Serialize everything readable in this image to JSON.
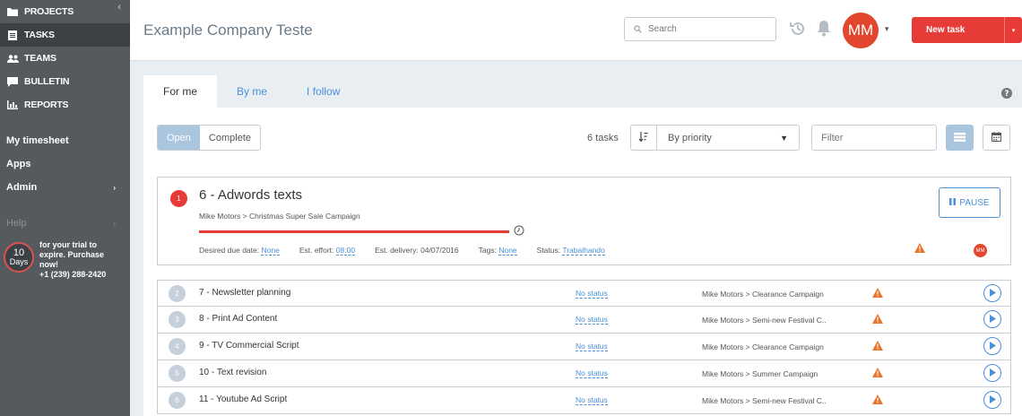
{
  "sidebar": {
    "collapse_glyph": "‹",
    "nav": [
      {
        "label": "PROJECTS",
        "icon": "folder-icon"
      },
      {
        "label": "TASKS",
        "icon": "tasks-icon"
      },
      {
        "label": "TEAMS",
        "icon": "teams-icon"
      },
      {
        "label": "BULLETIN",
        "icon": "bulletin-icon"
      },
      {
        "label": "REPORTS",
        "icon": "reports-icon"
      }
    ],
    "active_nav": "TASKS",
    "links": [
      {
        "label": "My timesheet"
      },
      {
        "label": "Apps"
      },
      {
        "label": "Admin",
        "caret": "›"
      }
    ],
    "help": {
      "label": "Help",
      "caret": "›"
    },
    "trial": {
      "days_number": "10",
      "days_unit": "Days",
      "line1": "for your trial to",
      "line2": "expire. Purchase",
      "line3": "now!",
      "phone": "+1 (239) 288-2420"
    }
  },
  "header": {
    "company": "Example Company Teste",
    "search_placeholder": "Search",
    "avatar_initials": "MM",
    "avatar_caret": "▾",
    "new_task_label": "New task",
    "new_task_caret": "▾",
    "colors": {
      "accent": "#e63b36",
      "avatar": "#e2462c",
      "link": "#4a90d9"
    }
  },
  "tabs": [
    {
      "label": "For me",
      "active": true
    },
    {
      "label": "By me",
      "active": false
    },
    {
      "label": "I follow",
      "active": false
    }
  ],
  "toolbar": {
    "open_label": "Open",
    "complete_label": "Complete",
    "task_count": "6 tasks",
    "sort_value": "By priority",
    "sort_caret": "▼",
    "filter_placeholder": "Filter"
  },
  "expanded_task": {
    "number": "1",
    "title": "6 - Adwords texts",
    "breadcrumb": "Mike Motors > Christmas Super Sale Campaign",
    "due_label": "Desired due date:",
    "due_value": "None",
    "effort_label": "Est. effort:",
    "effort_value": "08:00",
    "delivery": "Est. delivery: 04/07/2016",
    "tags_label": "Tags:",
    "tags_value": "None",
    "status_label": "Status:",
    "status_value": "Trabalhando",
    "pause_label": "PAUSE",
    "assignee_initials": "MM"
  },
  "tasks": [
    {
      "number": "2",
      "title": "7 - Newsletter planning",
      "status": "No status",
      "project": "Mike Motors > Clearance Campaign"
    },
    {
      "number": "3",
      "title": "8 - Print Ad Content",
      "status": "No status",
      "project": "Mike Motors > Semi-new Festival C.."
    },
    {
      "number": "4",
      "title": "9 - TV Commercial Script",
      "status": "No status",
      "project": "Mike Motors > Clearance Campaign"
    },
    {
      "number": "5",
      "title": "10 - Text revision",
      "status": "No status",
      "project": "Mike Motors > Summer Campaign"
    },
    {
      "number": "6",
      "title": "11 - Youtube Ad Script",
      "status": "No status",
      "project": "Mike Motors > Semi-new Festival C.."
    }
  ]
}
